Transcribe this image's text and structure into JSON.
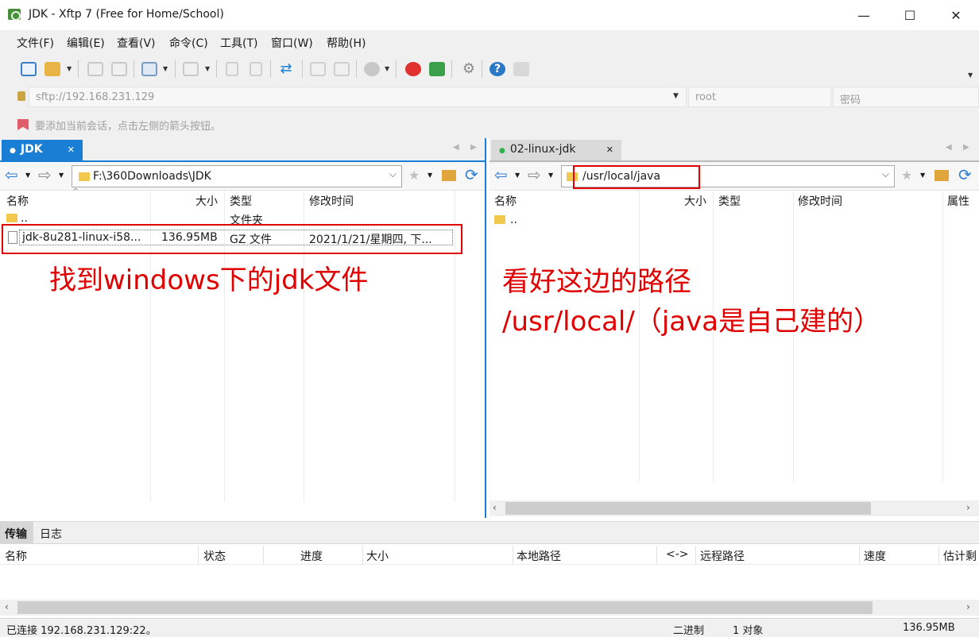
{
  "window": {
    "title": "JDK - Xftp 7 (Free for Home/School)",
    "minimize_glyph": "—",
    "maximize_glyph": "☐",
    "close_glyph": "✕"
  },
  "menu": [
    "文件(F)",
    "编辑(E)",
    "查看(V)",
    "命令(C)",
    "工具(T)",
    "窗口(W)",
    "帮助(H)"
  ],
  "address": {
    "host_placeholder": "sftp://192.168.231.129",
    "user_placeholder": "root",
    "password_placeholder": "密码"
  },
  "hint": "要添加当前会话，点击左侧的箭头按钮。",
  "left_pane": {
    "tab_label": "JDK",
    "path": "F:\\360Downloads\\JDK",
    "columns": [
      "名称",
      "大小",
      "类型",
      "修改时间"
    ],
    "rows": [
      {
        "name": "..",
        "size": "",
        "type": "文件夹",
        "modified": ""
      },
      {
        "name": "jdk-8u281-linux-i58...",
        "size": "136.95MB",
        "type": "GZ 文件",
        "modified": "2021/1/21/星期四, 下..."
      }
    ],
    "annotation": "找到windows下的jdk文件"
  },
  "right_pane": {
    "tab_label": "02-linux-jdk",
    "path": "/usr/local/java",
    "columns": [
      "名称",
      "大小",
      "类型",
      "修改时间",
      "属性"
    ],
    "rows": [
      {
        "name": ".."
      }
    ],
    "annotation_line1": "看好这边的路径",
    "annotation_line2": "/usr/local/（java是自己建的）"
  },
  "transfer": {
    "tabs": [
      "传输",
      "日志"
    ],
    "columns": [
      "名称",
      "状态",
      "进度",
      "大小",
      "本地路径",
      "<->",
      "远程路径",
      "速度",
      "估计剩"
    ]
  },
  "status": {
    "connection": "已连接 192.168.231.129:22。",
    "mode": "二进制",
    "objects": "1 对象",
    "size": "136.95MB"
  },
  "colors": {
    "accent": "#1a7fd4",
    "annotation": "#e00000",
    "connected_dot": "#2fb34a"
  }
}
